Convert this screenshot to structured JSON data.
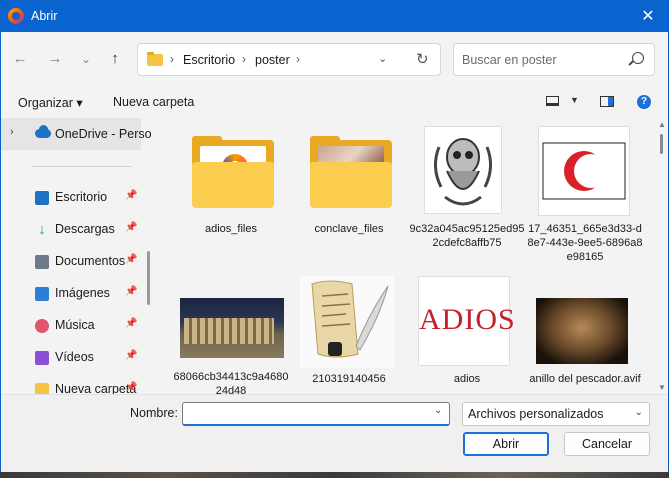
{
  "window": {
    "title": "Abrir",
    "close_glyph": "✕"
  },
  "nav": {
    "back": "←",
    "forward": "→",
    "recent": "⌄",
    "up": "↑"
  },
  "address": {
    "breadcrumbs": [
      "Escritorio",
      "poster"
    ],
    "separator": "›",
    "dropdown": "⌄",
    "refresh": "↻"
  },
  "search": {
    "placeholder": "Buscar en poster"
  },
  "commands": {
    "organize": "Organizar ▾",
    "new_folder": "Nueva carpeta",
    "view_dd": "▼",
    "help": "?"
  },
  "sidebar": {
    "onedrive": {
      "label": "OneDrive - Perso",
      "chevron": "›"
    },
    "pin_glyph": "📌",
    "items": [
      {
        "label": "Escritorio",
        "color": "#1d72c5",
        "icon": "desktop-icon"
      },
      {
        "label": "Descargas",
        "color": "#1e9e5a",
        "icon": "download-icon"
      },
      {
        "label": "Documentos",
        "color": "#6d7a8a",
        "icon": "document-icon"
      },
      {
        "label": "Imágenes",
        "color": "#2b7fd9",
        "icon": "pictures-icon"
      },
      {
        "label": "Música",
        "color": "#e0566b",
        "icon": "music-icon"
      },
      {
        "label": "Vídeos",
        "color": "#8a4fd6",
        "icon": "videos-icon"
      },
      {
        "label": "Nueva carpeta",
        "color": "#f6c444",
        "icon": "folder-icon"
      }
    ]
  },
  "files": [
    {
      "name": "adios_files",
      "kind": "folder-logo"
    },
    {
      "name": "conclave_files",
      "kind": "folder-photo"
    },
    {
      "name": "9c32a045ac95125ed952cdefc8affb75",
      "kind": "skull"
    },
    {
      "name": "17_46351_665e3d33-d8e7-443e-9ee5-6896a8e98165",
      "kind": "crescent"
    },
    {
      "name": "68066cb34413c9a468024d48",
      "kind": "building"
    },
    {
      "name": "210319140456",
      "kind": "quill"
    },
    {
      "name": "adios",
      "kind": "adios-text",
      "thumb_text": "ADIOS"
    },
    {
      "name": "anillo del pescador.avif",
      "kind": "ring"
    }
  ],
  "bottom": {
    "name_label": "Nombre:",
    "name_value": "",
    "filetype": "Archivos personalizados",
    "open": "Abrir",
    "cancel": "Cancelar"
  },
  "colors": {
    "accent": "#0a64d0",
    "crescent": "#d8222a",
    "adios": "#c4222b"
  }
}
